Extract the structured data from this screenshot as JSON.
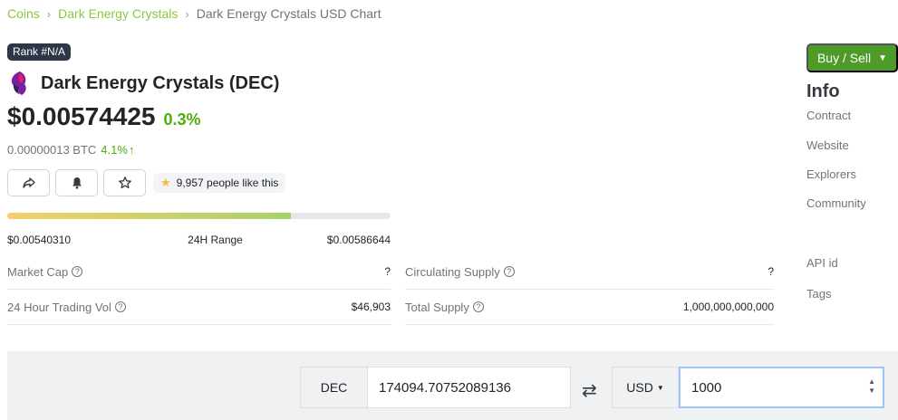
{
  "breadcrumb": {
    "items": [
      "Coins",
      "Dark Energy Crystals"
    ],
    "current": "Dark Energy Crystals USD Chart",
    "separator": "›"
  },
  "coin": {
    "rank": "Rank #N/A",
    "name": "Dark Energy Crystals (DEC)",
    "price": "$0.00574425",
    "price_change": "0.3%",
    "btc_price": "0.00000013 BTC",
    "btc_change": "4.1%",
    "likes": "9,957 people like this"
  },
  "range": {
    "low": "$0.00540310",
    "label": "24H Range",
    "high": "$0.00586644",
    "fill_fraction": 0.74
  },
  "stats": {
    "market_cap": {
      "label": "Market Cap",
      "value": "?"
    },
    "circulating_supply": {
      "label": "Circulating Supply",
      "value": "?"
    },
    "trading_vol": {
      "label": "24 Hour Trading Vol",
      "value": "$46,903"
    },
    "total_supply": {
      "label": "Total Supply",
      "value": "1,000,000,000,000"
    }
  },
  "sidebar": {
    "buy_sell": "Buy / Sell",
    "info_heading": "Info",
    "items": [
      "Contract",
      "Website",
      "Explorers",
      "Community",
      "API id",
      "Tags"
    ]
  },
  "converter": {
    "from_symbol": "DEC",
    "from_value": "174094.70752089136",
    "to_symbol": "USD",
    "to_value": "1000"
  },
  "colors": {
    "accent_green": "#8dc63f",
    "positive": "#4eaf0a",
    "buy_button": "#4e9b2a"
  }
}
